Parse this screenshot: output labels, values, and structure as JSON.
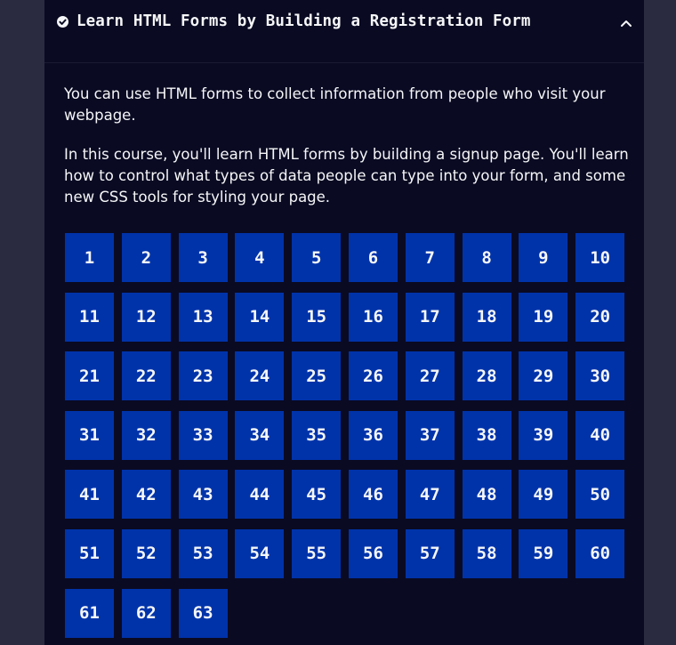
{
  "header": {
    "title": "Learn HTML Forms by Building a Registration Form",
    "status_icon": "check-circle-icon",
    "toggle_icon": "chevron-up-icon"
  },
  "description": [
    "You can use HTML forms to collect information from people who visit your webpage.",
    "In this course, you'll learn HTML forms by building a signup page. You'll learn how to control what types of data people can type into your form, and some new CSS tools for styling your page."
  ],
  "steps": [
    "1",
    "2",
    "3",
    "4",
    "5",
    "6",
    "7",
    "8",
    "9",
    "10",
    "11",
    "12",
    "13",
    "14",
    "15",
    "16",
    "17",
    "18",
    "19",
    "20",
    "21",
    "22",
    "23",
    "24",
    "25",
    "26",
    "27",
    "28",
    "29",
    "30",
    "31",
    "32",
    "33",
    "34",
    "35",
    "36",
    "37",
    "38",
    "39",
    "40",
    "41",
    "42",
    "43",
    "44",
    "45",
    "46",
    "47",
    "48",
    "49",
    "50",
    "51",
    "52",
    "53",
    "54",
    "55",
    "56",
    "57",
    "58",
    "59",
    "60",
    "61",
    "62",
    "63"
  ],
  "colors": {
    "panel_bg": "#0a0a23",
    "step_bg": "#0033aa",
    "text": "#f5f6f7"
  }
}
